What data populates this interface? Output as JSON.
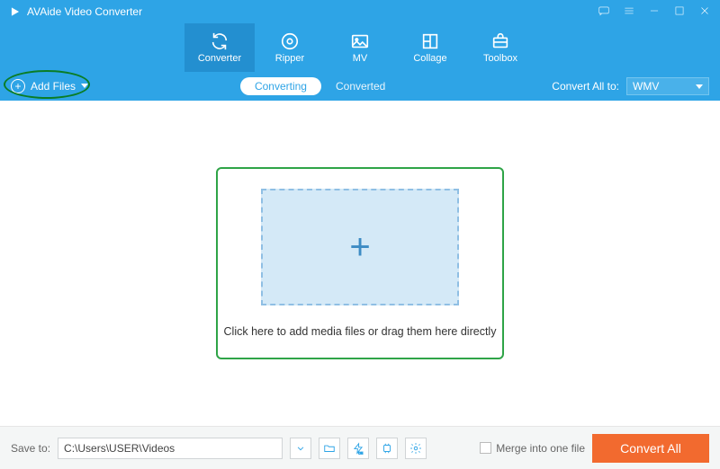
{
  "window": {
    "title": "AVAide Video Converter"
  },
  "nav": {
    "items": [
      {
        "label": "Converter",
        "icon": "sync-icon",
        "active": true
      },
      {
        "label": "Ripper",
        "icon": "disc-icon",
        "active": false
      },
      {
        "label": "MV",
        "icon": "photo-icon",
        "active": false
      },
      {
        "label": "Collage",
        "icon": "grid-icon",
        "active": false
      },
      {
        "label": "Toolbox",
        "icon": "toolbox-icon",
        "active": false
      }
    ]
  },
  "subbar": {
    "add_label": "Add Files",
    "tabs": {
      "converting": "Converting",
      "converted": "Converted",
      "active": "converting"
    },
    "convert_all_label": "Convert All to:",
    "format": "WMV"
  },
  "dropzone": {
    "text": "Click here to add media files or drag them here directly"
  },
  "footer": {
    "save_to_label": "Save to:",
    "save_path": "C:\\Users\\USER\\Videos",
    "merge_label": "Merge into one file",
    "merge_checked": false,
    "convert_button": "Convert All"
  },
  "colors": {
    "primary": "#2ea4e6",
    "primary_dark": "#238fd0",
    "accent_orange": "#f26a2f",
    "highlight_green": "#2fa447"
  }
}
